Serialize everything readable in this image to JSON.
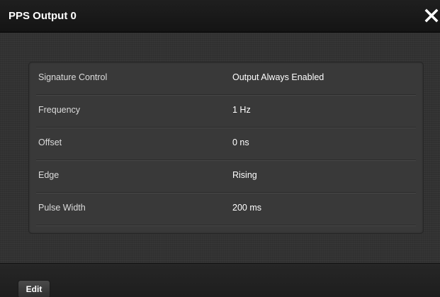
{
  "dialog": {
    "title": "PPS Output 0",
    "close_icon": "close-icon"
  },
  "settings": [
    {
      "label": "Signature Control",
      "value": "Output Always Enabled"
    },
    {
      "label": "Frequency",
      "value": "1 Hz"
    },
    {
      "label": "Offset",
      "value": "0 ns"
    },
    {
      "label": "Edge",
      "value": "Rising"
    },
    {
      "label": "Pulse Width",
      "value": "200 ms"
    }
  ],
  "footer": {
    "edit_label": "Edit"
  },
  "colors": {
    "background": "#2e2e2e",
    "panel": "#393939",
    "text": "#ffffff"
  }
}
